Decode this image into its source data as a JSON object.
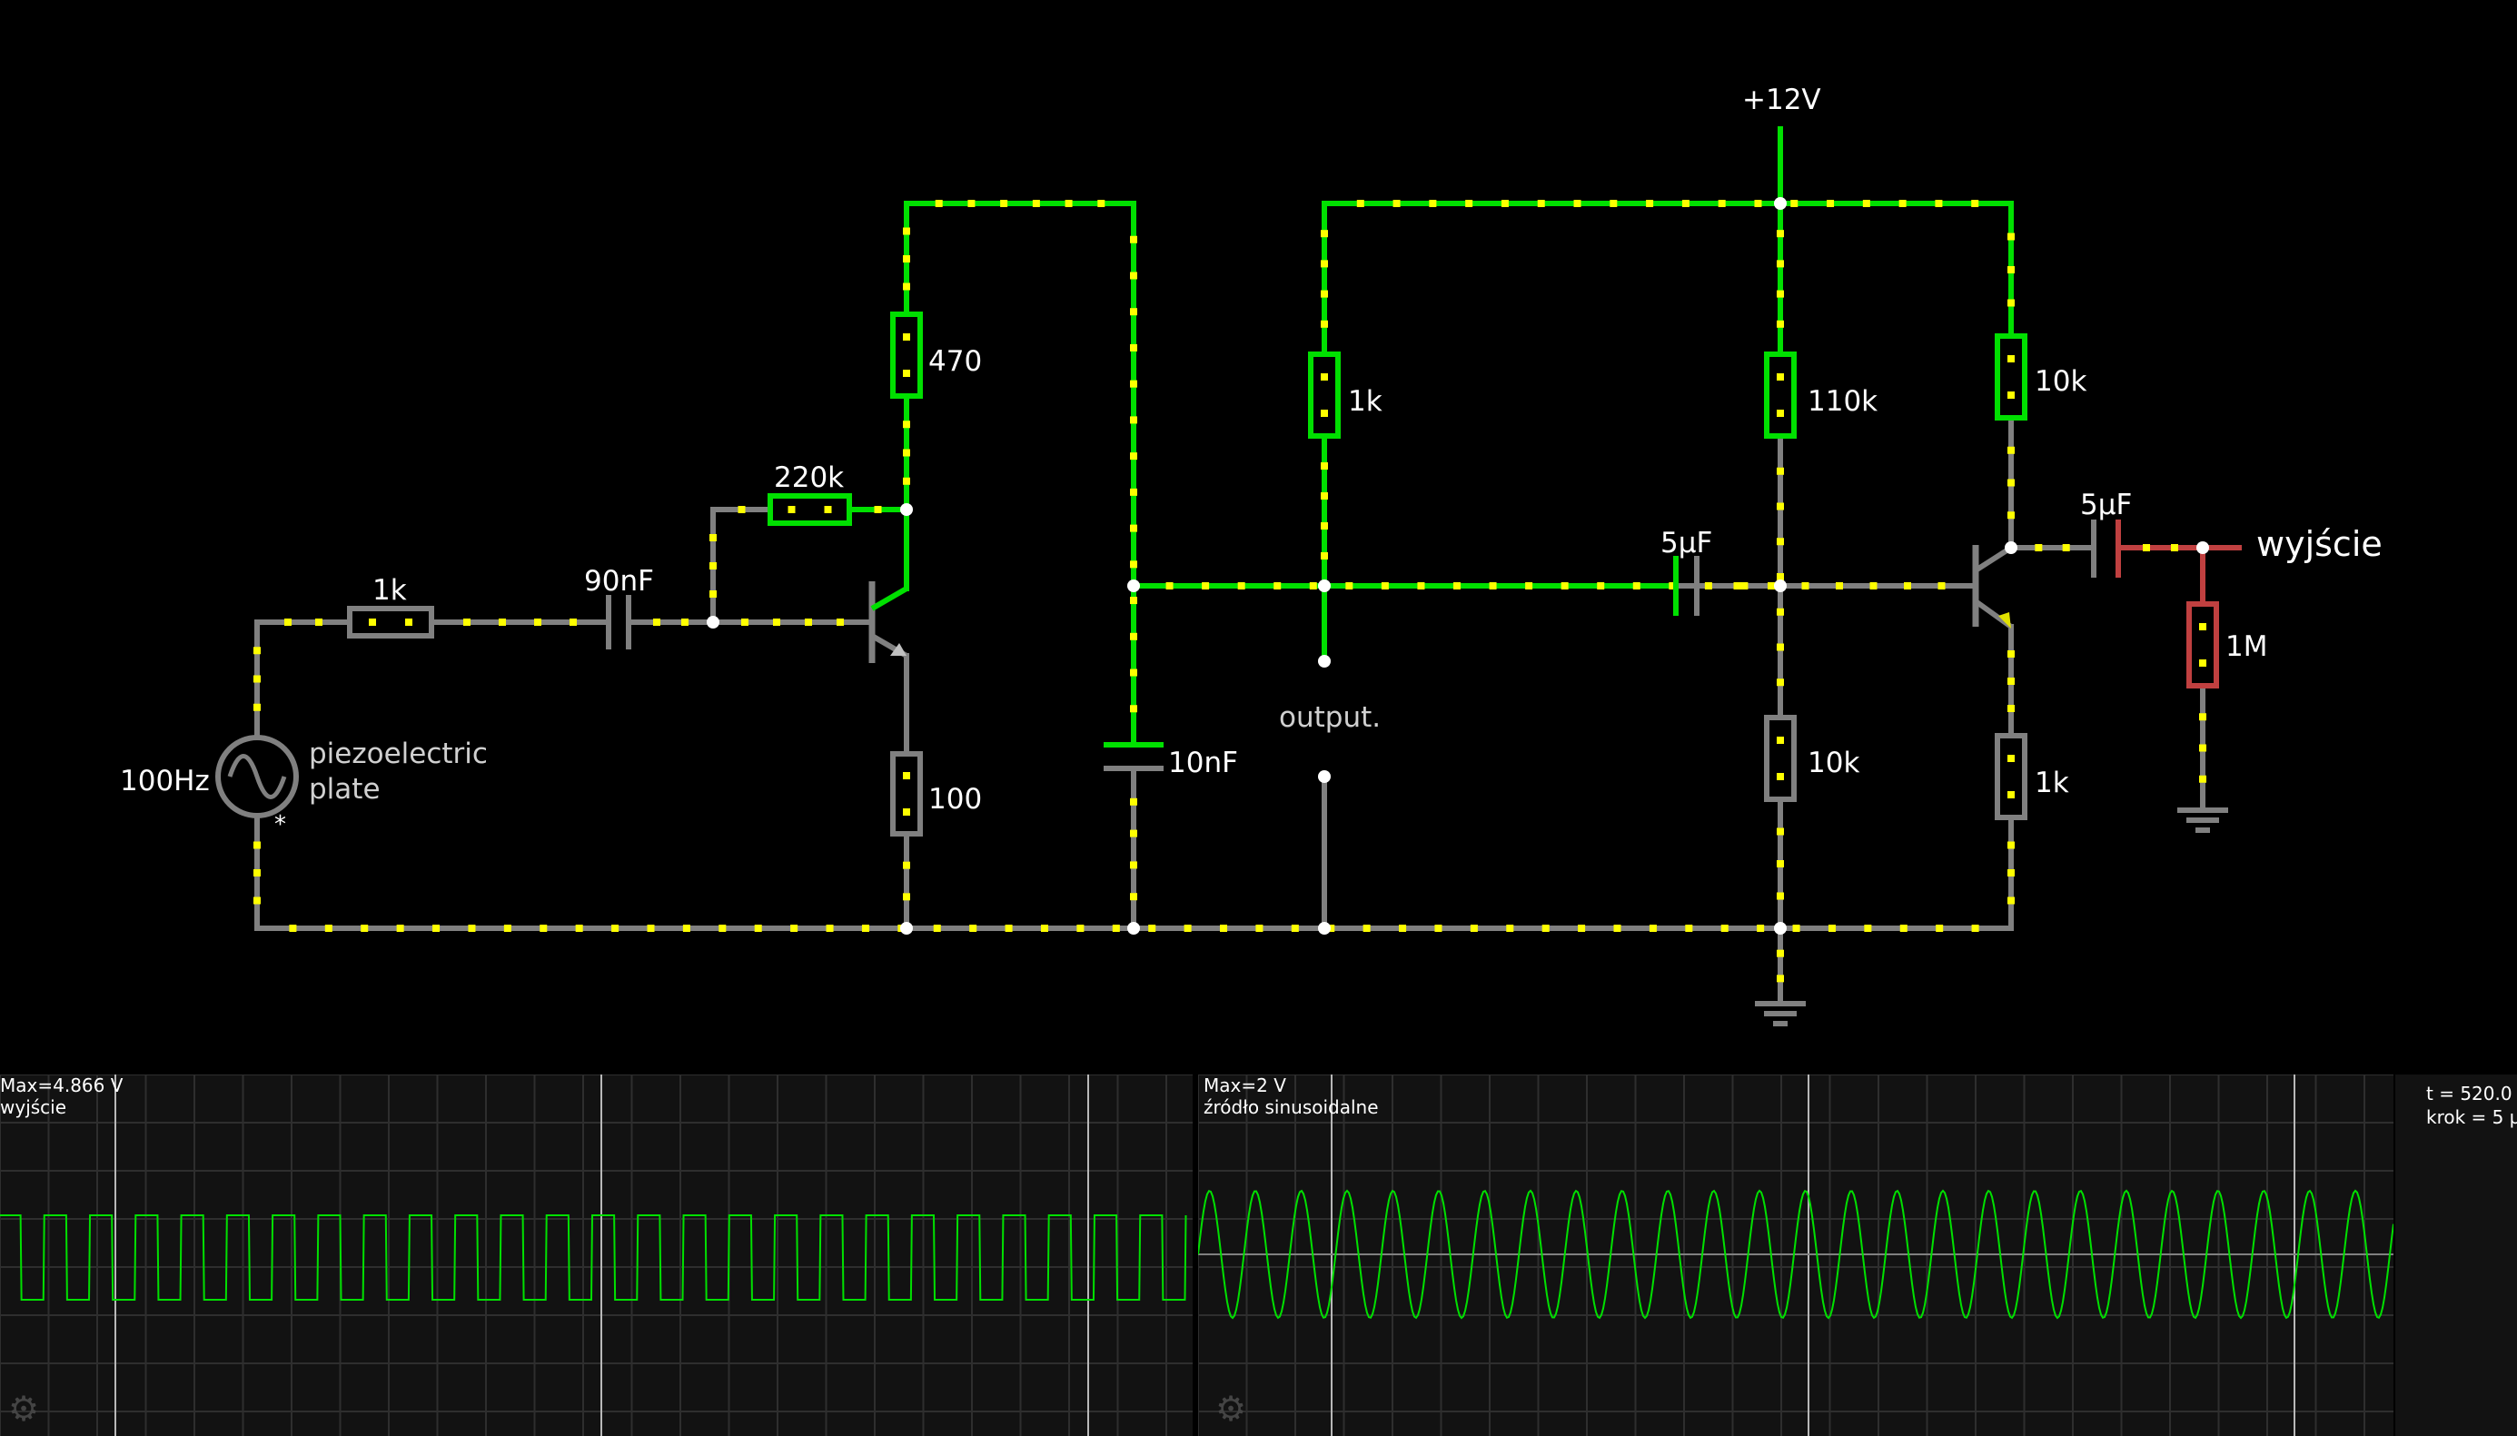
{
  "circuit": {
    "labels": {
      "supply": "+12V",
      "r_in": "1k",
      "c_in": "90nF",
      "r_fb": "220k",
      "r_collector1": "470",
      "r_emitter1": "100",
      "c_filter": "10nF",
      "r_output_node": "1k",
      "output_label": "output.",
      "r_bias_top": "110k",
      "r_bias_bottom": "10k",
      "c_coupling": "5µF",
      "r_collector2": "10k",
      "r_emitter2": "1k",
      "c_out": "5µF",
      "r_load": "1M",
      "out_label": "wyjście",
      "source_freq": "100Hz",
      "source_name_line1": "piezoelectric",
      "source_name_line2": "plate",
      "source_marker": "*"
    },
    "colors": {
      "wire_idle": "#808080",
      "wire_active": "#00e000",
      "wire_negative": "#c04040",
      "current_dots": "#ffff00",
      "node": "#ffffff"
    }
  },
  "scopes": [
    {
      "max_label": "Max=4.866 V",
      "name": "wyjście",
      "waveform": "square",
      "cycles": 26,
      "color": "#00e000",
      "settings_icon": "gear-icon"
    },
    {
      "max_label": "Max=2 V",
      "name": "źródło sinusoidalne",
      "waveform": "sine",
      "cycles": 26,
      "color": "#00e000",
      "settings_icon": "gear-icon"
    }
  ],
  "sim_info": {
    "time": "t = 520.0",
    "step": "krok = 5 µ"
  }
}
